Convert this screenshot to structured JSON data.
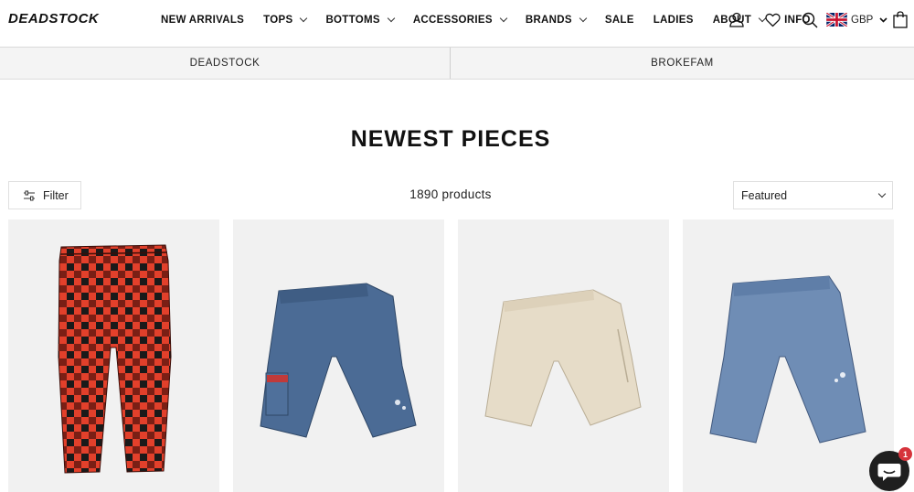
{
  "header": {
    "logo_text": "DEADSTOCK",
    "nav": [
      {
        "label": "NEW ARRIVALS",
        "has_dropdown": false
      },
      {
        "label": "TOPS",
        "has_dropdown": true
      },
      {
        "label": "BOTTOMS",
        "has_dropdown": true
      },
      {
        "label": "ACCESSORIES",
        "has_dropdown": true
      },
      {
        "label": "BRANDS",
        "has_dropdown": true
      },
      {
        "label": "SALE",
        "has_dropdown": false
      },
      {
        "label": "LADIES",
        "has_dropdown": false
      },
      {
        "label": "ABOUT",
        "has_dropdown": true
      },
      {
        "label": "INFO",
        "has_dropdown": false
      }
    ],
    "icons": [
      "account-icon",
      "wishlist-heart-icon",
      "search-icon",
      "uk-flag-icon",
      "cart-bag-icon"
    ],
    "currency": "GBP"
  },
  "collections": [
    {
      "label": "DEADSTOCK"
    },
    {
      "label": "BROKEFAM"
    }
  ],
  "title": "NEWEST PIECES",
  "toolbar": {
    "filter_label": "Filter",
    "product_count": "1890 products",
    "sort_selected": "Featured"
  },
  "products": [
    {
      "image": "red and black check trousers",
      "colors": {
        "primary": "#e2402b",
        "secondary": "#1a1a1a"
      }
    },
    {
      "image": "blue denim cargo shorts",
      "colors": {
        "primary": "#4b6b95"
      }
    },
    {
      "image": "beige carpenter shorts",
      "colors": {
        "primary": "#e6dcc8"
      }
    },
    {
      "image": "light wash denim shorts",
      "colors": {
        "primary": "#6f8db5"
      }
    }
  ],
  "chat": {
    "badge_count": "1"
  },
  "colors": {
    "accent_badge": "#d6333b",
    "card_bg": "#f1f1f1",
    "collection_bar_bg": "#f4f4f4"
  }
}
